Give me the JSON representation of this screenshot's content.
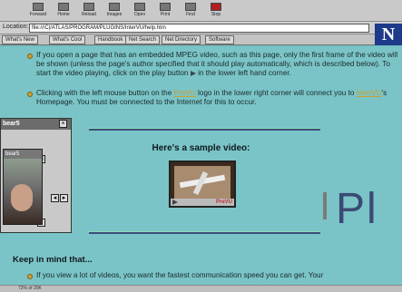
{
  "toolbar": {
    "buttons": [
      {
        "label": "Forward",
        "icon": "forward-icon"
      },
      {
        "label": "Home",
        "icon": "home-icon"
      },
      {
        "label": "Reload",
        "icon": "reload-icon"
      },
      {
        "label": "Images",
        "icon": "images-icon"
      },
      {
        "label": "Open",
        "icon": "open-icon"
      },
      {
        "label": "Print",
        "icon": "print-icon"
      },
      {
        "label": "Find",
        "icon": "find-icon"
      },
      {
        "label": "Stop",
        "icon": "stop-icon"
      }
    ]
  },
  "location": {
    "label": "Location:",
    "url": "file:///C|/ATLAS/PROGRAM/PLUGINS/InterVU/help.htm"
  },
  "directory": {
    "buttons": [
      "What's New",
      "What's Cool",
      "Handbook",
      "Net Search",
      "Net Directory",
      "Software"
    ]
  },
  "content": {
    "para1": "If you open a page that has an embedded MPEG video, such as this page, only the first frame of the video will be shown (unless the page's author specified that it should play automatically, which is described below). To start the video playing, click on the play button",
    "para1_tail": "in the lower left hand corner.",
    "para2_a": "Clicking with the left mouse button on the",
    "para2_link1": "PreVU",
    "para2_b": "logo in the lower right corner will connect you to",
    "para2_link2": "InterVU",
    "para2_c": "'s Homepage. You must be connected to the Internet for this to occur.",
    "sample_title": "Here's a sample video:",
    "video_logo": "PreVU",
    "big_text": "Pl",
    "keep_heading": "Keep in mind that...",
    "para3": "If you view a lot of videos, you want the fastest communication speed you can get. Your"
  },
  "float_window": {
    "title": "bear5",
    "inner_title": "bear5"
  },
  "status": {
    "text": "72% of 20K"
  }
}
